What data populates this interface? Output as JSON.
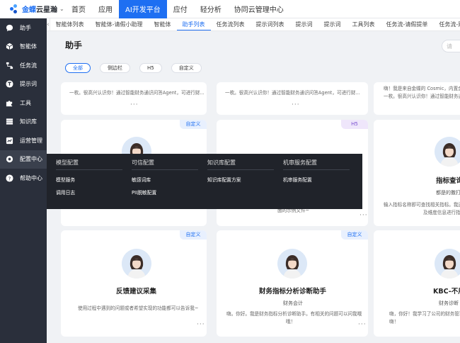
{
  "brand": {
    "name_part1": "金蝶",
    "name_part2": "云星瀚",
    "accent": "#1e6ff2"
  },
  "topnav": [
    {
      "label": "首页"
    },
    {
      "label": "应用"
    },
    {
      "label": "AI开发平台",
      "active": true
    },
    {
      "label": "应付"
    },
    {
      "label": "轻分析"
    },
    {
      "label": "协同云管理中心"
    }
  ],
  "sidebar": [
    {
      "label": "助手",
      "icon": "chat-bubble-icon"
    },
    {
      "label": "智能体",
      "icon": "cube-icon"
    },
    {
      "label": "任务流",
      "icon": "flow-icon"
    },
    {
      "label": "提示词",
      "icon": "t-circle-icon"
    },
    {
      "label": "工具",
      "icon": "puzzle-icon"
    },
    {
      "label": "知识库",
      "icon": "database-icon"
    },
    {
      "label": "运营管理",
      "icon": "chart-icon"
    },
    {
      "label": "配置中心",
      "icon": "gear-icon",
      "active": true
    },
    {
      "label": "帮助中心",
      "icon": "question-icon"
    }
  ],
  "tabs": [
    {
      "label": "智能体列表"
    },
    {
      "label": "智能体-请假小助理"
    },
    {
      "label": "智能体"
    },
    {
      "label": "助手列表",
      "active": true
    },
    {
      "label": "任务流列表"
    },
    {
      "label": "提示词列表"
    },
    {
      "label": "提示词"
    },
    {
      "label": "提示词"
    },
    {
      "label": "工具列表"
    },
    {
      "label": "任务流-请假提单"
    },
    {
      "label": "任务流-财务报告生成"
    }
  ],
  "page_title": "助手",
  "search_placeholder": "请",
  "filters": [
    {
      "label": "全部",
      "active": true
    },
    {
      "label": "侧边栏"
    },
    {
      "label": "H5"
    },
    {
      "label": "自定义"
    }
  ],
  "row1_descs": [
    "一枚。很高兴认识你！通过智能财务通识问答Agent，可进行财...",
    "一枚。很高兴认识你！通过智能财务通识问答Agent，可进行财...",
    "嗨！我是来自金蝶的 Cosmic，内置金蝶的",
    "一枚。很高兴认识你！通过智能财务通识问答"
  ],
  "row2": [
    {
      "badge": "自定义"
    },
    {
      "badge": "H5",
      "desc": "面的示例文件~"
    },
    {
      "name": "指标查询",
      "sub": "都是的撒打算",
      "desc1": "输入指标名称即可查找相关指标。我还",
      "desc2": "及维度信息进行指"
    }
  ],
  "row3": [
    {
      "badge": "自定义",
      "name": "反馈建议采集",
      "desc1": "使用过程中遇到的问题或者希望实现的功能都可以告诉我~"
    },
    {
      "badge": "自定义",
      "name": "财务指标分析诊断助手",
      "sub": "财务会计",
      "desc1": "嗨。你好。我是财务指标分析诊断助手。有相关的问题可以问我哦",
      "desc2": "哦！"
    },
    {
      "name": "KBC-不用",
      "sub": "财务诊断",
      "desc1": "嗨，你好！我学习了公司的财务管理",
      "desc2": "嗨！"
    }
  ],
  "config_menu": [
    {
      "heading": "模型配置",
      "options": [
        "模型服务",
        "调用日志"
      ]
    },
    {
      "heading": "可信配置",
      "options": [
        "敏感词库",
        "PII脱敏配置"
      ]
    },
    {
      "heading": "知识库配置",
      "options": [
        "知识库配置方案"
      ]
    },
    {
      "heading": "机审服务配置",
      "options": [
        "机审服务配置"
      ]
    }
  ],
  "more_label": "···"
}
